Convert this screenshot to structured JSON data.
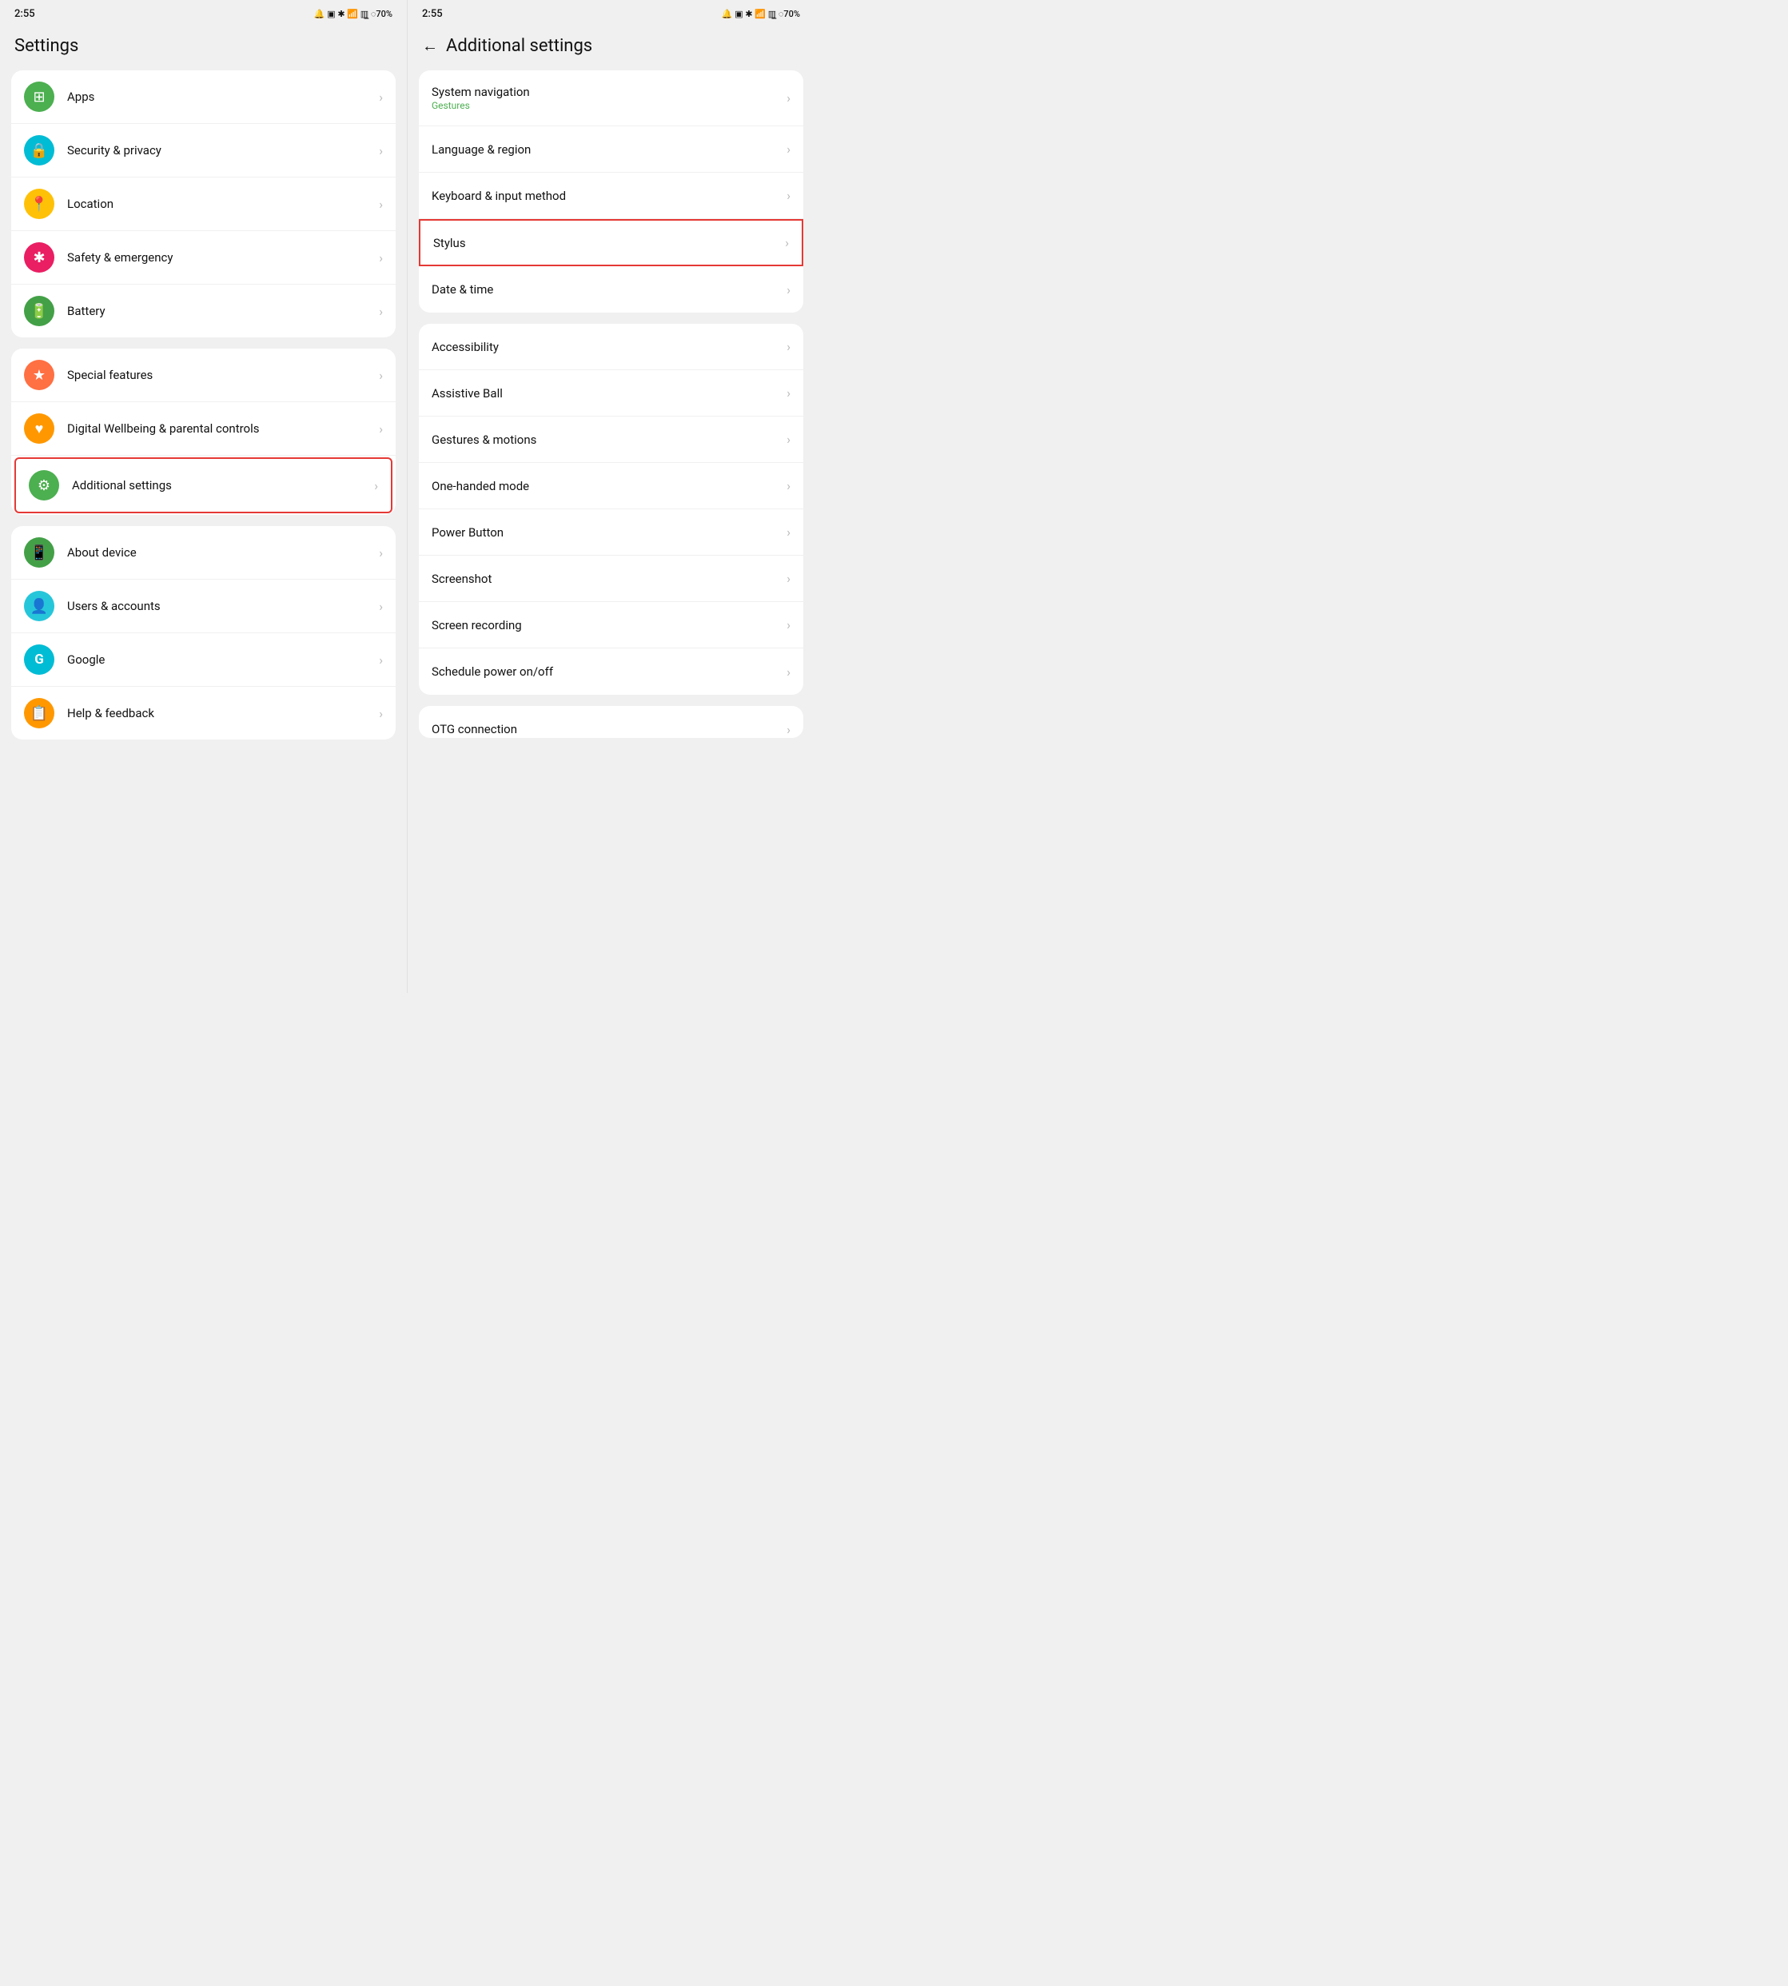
{
  "left": {
    "statusBar": {
      "time": "2:55",
      "icons": "🔔 📳 ✻ 📶 📶 🔋70%"
    },
    "title": "Settings",
    "groups": [
      {
        "items": [
          {
            "id": "apps",
            "label": "Apps",
            "icon": "⊞",
            "iconBg": "bg-green",
            "sublabel": ""
          },
          {
            "id": "security",
            "label": "Security & privacy",
            "icon": "🔒",
            "iconBg": "bg-teal",
            "sublabel": ""
          },
          {
            "id": "location",
            "label": "Location",
            "icon": "📍",
            "iconBg": "bg-yellow",
            "sublabel": ""
          },
          {
            "id": "safety",
            "label": "Safety & emergency",
            "icon": "✱",
            "iconBg": "bg-pink",
            "sublabel": ""
          },
          {
            "id": "battery",
            "label": "Battery",
            "icon": "🔋",
            "iconBg": "bg-green2",
            "sublabel": ""
          }
        ]
      },
      {
        "items": [
          {
            "id": "special",
            "label": "Special features",
            "icon": "★",
            "iconBg": "bg-orange",
            "sublabel": ""
          },
          {
            "id": "wellbeing",
            "label": "Digital Wellbeing & parental controls",
            "icon": "♥",
            "iconBg": "bg-orange2",
            "sublabel": ""
          },
          {
            "id": "additional",
            "label": "Additional settings",
            "icon": "⚙",
            "iconBg": "bg-green",
            "sublabel": "",
            "highlighted": true
          }
        ]
      },
      {
        "items": [
          {
            "id": "about",
            "label": "About device",
            "icon": "📱",
            "iconBg": "bg-green2",
            "sublabel": ""
          },
          {
            "id": "users",
            "label": "Users & accounts",
            "icon": "👤",
            "iconBg": "bg-teal2",
            "sublabel": ""
          },
          {
            "id": "google",
            "label": "Google",
            "icon": "G",
            "iconBg": "bg-teal",
            "sublabel": ""
          },
          {
            "id": "help",
            "label": "Help & feedback",
            "icon": "📋",
            "iconBg": "bg-orange2",
            "sublabel": ""
          }
        ]
      }
    ]
  },
  "right": {
    "statusBar": {
      "time": "2:55",
      "icons": "🔔 📳 ✻ 📶 📶 🔋70%"
    },
    "backLabel": "←",
    "title": "Additional settings",
    "groups": [
      {
        "items": [
          {
            "id": "system-nav",
            "label": "System navigation",
            "sublabel": "Gestures",
            "highlighted": false
          },
          {
            "id": "language",
            "label": "Language & region",
            "sublabel": "",
            "highlighted": false
          },
          {
            "id": "keyboard",
            "label": "Keyboard & input method",
            "sublabel": "",
            "highlighted": false
          },
          {
            "id": "stylus",
            "label": "Stylus",
            "sublabel": "",
            "highlighted": true
          },
          {
            "id": "datetime",
            "label": "Date & time",
            "sublabel": "",
            "highlighted": false
          }
        ]
      },
      {
        "items": [
          {
            "id": "accessibility",
            "label": "Accessibility",
            "sublabel": "",
            "highlighted": false
          },
          {
            "id": "assistive",
            "label": "Assistive Ball",
            "sublabel": "",
            "highlighted": false
          },
          {
            "id": "gestures",
            "label": "Gestures & motions",
            "sublabel": "",
            "highlighted": false
          },
          {
            "id": "onehanded",
            "label": "One-handed mode",
            "sublabel": "",
            "highlighted": false
          },
          {
            "id": "powerbutton",
            "label": "Power Button",
            "sublabel": "",
            "highlighted": false
          },
          {
            "id": "screenshot",
            "label": "Screenshot",
            "sublabel": "",
            "highlighted": false
          },
          {
            "id": "screenrec",
            "label": "Screen recording",
            "sublabel": "",
            "highlighted": false
          },
          {
            "id": "schedule",
            "label": "Schedule power on/off",
            "sublabel": "",
            "highlighted": false
          }
        ]
      },
      {
        "items": [
          {
            "id": "otg",
            "label": "OTG connection",
            "sublabel": "",
            "highlighted": false
          }
        ]
      }
    ]
  }
}
